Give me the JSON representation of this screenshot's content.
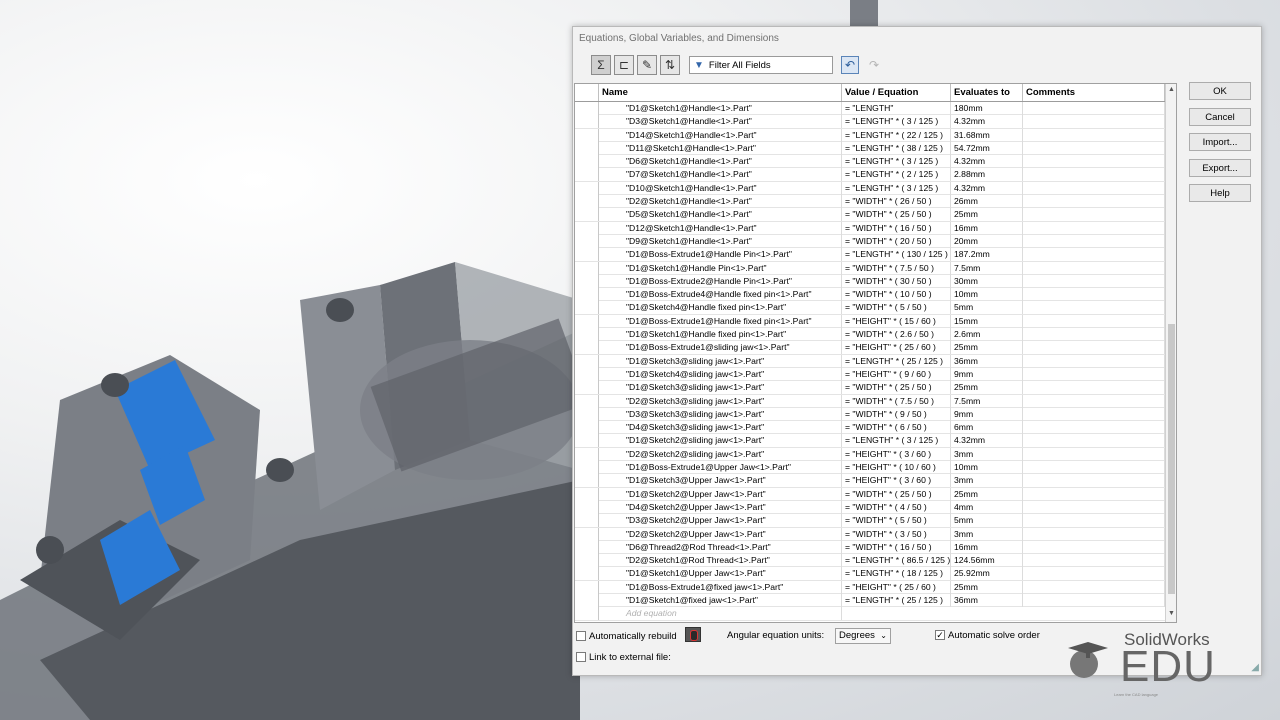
{
  "dialog": {
    "title": "Equations, Global Variables, and Dimensions",
    "filter_label": "Filter All Fields",
    "columns": [
      "Name",
      "Value / Equation",
      "Evaluates to",
      "Comments"
    ],
    "buttons": [
      "OK",
      "Cancel",
      "Import...",
      "Export...",
      "Help"
    ],
    "add_equation_placeholder": "Add equation",
    "rows": [
      [
        "\"D1@Sketch1@Handle<1>.Part\"",
        "= \"LENGTH\"",
        "180mm",
        ""
      ],
      [
        "\"D3@Sketch1@Handle<1>.Part\"",
        "= \"LENGTH\" * ( 3 / 125 )",
        "4.32mm",
        ""
      ],
      [
        "\"D14@Sketch1@Handle<1>.Part\"",
        "= \"LENGTH\" * ( 22 / 125 )",
        "31.68mm",
        ""
      ],
      [
        "\"D11@Sketch1@Handle<1>.Part\"",
        "= \"LENGTH\" * ( 38 / 125 )",
        "54.72mm",
        ""
      ],
      [
        "\"D6@Sketch1@Handle<1>.Part\"",
        "= \"LENGTH\" * ( 3 / 125 )",
        "4.32mm",
        ""
      ],
      [
        "\"D7@Sketch1@Handle<1>.Part\"",
        "= \"LENGTH\" * ( 2 / 125 )",
        "2.88mm",
        ""
      ],
      [
        "\"D10@Sketch1@Handle<1>.Part\"",
        "= \"LENGTH\" * ( 3 / 125 )",
        "4.32mm",
        ""
      ],
      [
        "\"D2@Sketch1@Handle<1>.Part\"",
        "= \"WIDTH\" * ( 26 / 50 )",
        "26mm",
        ""
      ],
      [
        "\"D5@Sketch1@Handle<1>.Part\"",
        "= \"WIDTH\" * ( 25 / 50 )",
        "25mm",
        ""
      ],
      [
        "\"D12@Sketch1@Handle<1>.Part\"",
        "= \"WIDTH\" * ( 16 / 50 )",
        "16mm",
        ""
      ],
      [
        "\"D9@Sketch1@Handle<1>.Part\"",
        "= \"WIDTH\" * ( 20 / 50 )",
        "20mm",
        ""
      ],
      [
        "\"D1@Boss-Extrude1@Handle Pin<1>.Part\"",
        "= \"LENGTH\" * ( 130 / 125 )",
        "187.2mm",
        ""
      ],
      [
        "\"D1@Sketch1@Handle Pin<1>.Part\"",
        "= \"WIDTH\" * ( 7.5 / 50 )",
        "7.5mm",
        ""
      ],
      [
        "\"D1@Boss-Extrude2@Handle Pin<1>.Part\"",
        "= \"WIDTH\" * ( 30 / 50 )",
        "30mm",
        ""
      ],
      [
        "\"D1@Boss-Extrude4@Handle fixed pin<1>.Part\"",
        "= \"WIDTH\" * ( 10 / 50 )",
        "10mm",
        ""
      ],
      [
        "\"D1@Sketch4@Handle fixed pin<1>.Part\"",
        "= \"WIDTH\" * ( 5 / 50 )",
        "5mm",
        ""
      ],
      [
        "\"D1@Boss-Extrude1@Handle fixed pin<1>.Part\"",
        "= \"HEIGHT\" * ( 15 / 60 )",
        "15mm",
        ""
      ],
      [
        "\"D1@Sketch1@Handle fixed pin<1>.Part\"",
        "= \"WIDTH\" * ( 2.6 / 50 )",
        "2.6mm",
        ""
      ],
      [
        "\"D1@Boss-Extrude1@sliding jaw<1>.Part\"",
        "= \"HEIGHT\" * ( 25 / 60 )",
        "25mm",
        ""
      ],
      [
        "\"D1@Sketch3@sliding jaw<1>.Part\"",
        "= \"LENGTH\" * ( 25 / 125 )",
        "36mm",
        ""
      ],
      [
        "\"D1@Sketch4@sliding jaw<1>.Part\"",
        "= \"HEIGHT\" * ( 9 / 60 )",
        "9mm",
        ""
      ],
      [
        "\"D1@Sketch3@sliding jaw<1>.Part\"",
        "= \"WIDTH\" * ( 25 / 50 )",
        "25mm",
        ""
      ],
      [
        "\"D2@Sketch3@sliding jaw<1>.Part\"",
        "= \"WIDTH\" * ( 7.5 / 50 )",
        "7.5mm",
        ""
      ],
      [
        "\"D3@Sketch3@sliding jaw<1>.Part\"",
        "= \"WIDTH\" * ( 9 / 50 )",
        "9mm",
        ""
      ],
      [
        "\"D4@Sketch3@sliding jaw<1>.Part\"",
        "= \"WIDTH\" * ( 6 / 50 )",
        "6mm",
        ""
      ],
      [
        "\"D1@Sketch2@sliding jaw<1>.Part\"",
        "= \"LENGTH\" * ( 3 / 125 )",
        "4.32mm",
        ""
      ],
      [
        "\"D2@Sketch2@sliding jaw<1>.Part\"",
        "= \"HEIGHT\" * ( 3 / 60 )",
        "3mm",
        ""
      ],
      [
        "\"D1@Boss-Extrude1@Upper Jaw<1>.Part\"",
        "= \"HEIGHT\" * ( 10 / 60 )",
        "10mm",
        ""
      ],
      [
        "\"D1@Sketch3@Upper Jaw<1>.Part\"",
        "= \"HEIGHT\" * ( 3 / 60 )",
        "3mm",
        ""
      ],
      [
        "\"D1@Sketch2@Upper Jaw<1>.Part\"",
        "= \"WIDTH\" * ( 25 / 50 )",
        "25mm",
        ""
      ],
      [
        "\"D4@Sketch2@Upper Jaw<1>.Part\"",
        "= \"WIDTH\" * ( 4 / 50 )",
        "4mm",
        ""
      ],
      [
        "\"D3@Sketch2@Upper Jaw<1>.Part\"",
        "= \"WIDTH\" * ( 5 / 50 )",
        "5mm",
        ""
      ],
      [
        "\"D2@Sketch2@Upper Jaw<1>.Part\"",
        "= \"WIDTH\" * ( 3 / 50 )",
        "3mm",
        ""
      ],
      [
        "\"D6@Thread2@Rod Thread<1>.Part\"",
        "= \"WIDTH\" * ( 16 / 50 )",
        "16mm",
        ""
      ],
      [
        "\"D2@Sketch1@Rod Thread<1>.Part\"",
        "= \"LENGTH\" * ( 86.5 / 125 )",
        "124.56mm",
        ""
      ],
      [
        "\"D1@Sketch1@Upper Jaw<1>.Part\"",
        "= \"LENGTH\" * ( 18 / 125 )",
        "25.92mm",
        ""
      ],
      [
        "\"D1@Boss-Extrude1@fixed jaw<1>.Part\"",
        "= \"HEIGHT\" * ( 25 / 60 )",
        "25mm",
        ""
      ],
      [
        "\"D1@Sketch1@fixed jaw<1>.Part\"",
        "= \"LENGTH\" * ( 25 / 125 )",
        "36mm",
        ""
      ]
    ],
    "options": {
      "auto_rebuild_label": "Automatically rebuild",
      "angular_units_label": "Angular equation units:",
      "angular_units_value": "Degrees",
      "auto_solve_label": "Automatic solve order",
      "link_external_label": "Link to external file:"
    }
  },
  "logo": {
    "brand": "SolidWorks",
    "edu": "EDU",
    "tagline": "Learn the CAD language"
  }
}
